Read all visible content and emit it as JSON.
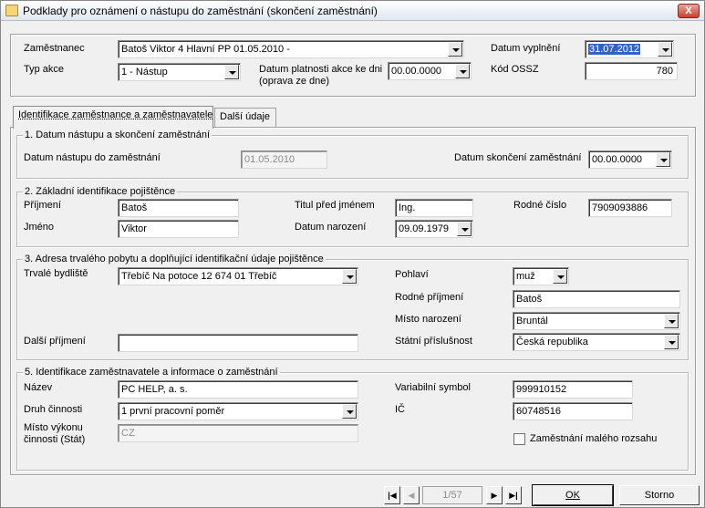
{
  "window": {
    "title": "Podklady pro oznámení o nástupu do zaměstnání (skončení zaměstnání)",
    "close_label": "X"
  },
  "header": {
    "employee_label": "Zaměstnanec",
    "employee_value": "Batoš Viktor 4 Hlavní PP 01.05.2010 -",
    "action_type_label": "Typ akce",
    "action_type_value": "1 - Nástup",
    "validity_label_1": "Datum platnosti akce ke dni",
    "validity_label_2": "(oprava ze dne)",
    "validity_value": "00.00.0000",
    "filled_date_label": "Datum vyplnění",
    "filled_date_value": "31.07.2012",
    "ossz_label": "Kód OSSZ",
    "ossz_value": "780"
  },
  "tabs": [
    {
      "label": "Identifikace zaměstnance a zaměstnavatele"
    },
    {
      "label": "Další údaje"
    }
  ],
  "section1": {
    "title": "1. Datum nástupu a skončení zaměstnání",
    "start_label": "Datum nástupu do zaměstnání",
    "start_value": "01.05.2010",
    "end_label": "Datum skončení zaměstnání",
    "end_value": "00.00.0000"
  },
  "section2": {
    "title": "2. Základní identifikace pojištěnce",
    "surname_label": "Příjmení",
    "surname_value": "Batoš",
    "firstname_label": "Jméno",
    "firstname_value": "Viktor",
    "title_label": "Titul před jménem",
    "title_value": "Ing.",
    "birthdate_label": "Datum narození",
    "birthdate_value": "09.09.1979",
    "birthnumber_label": "Rodné číslo",
    "birthnumber_value": "7909093886"
  },
  "section3": {
    "title": "3. Adresa trvalého pobytu a doplňující identifikační údaje pojištěnce",
    "address_label": "Trvalé bydliště",
    "address_value": "Třebíč  Na potoce 12    674 01 Třebíč",
    "gender_label": "Pohlaví",
    "gender_value": "muž",
    "maiden_label": "Rodné příjmení",
    "maiden_value": "Batoš",
    "birthplace_label": "Místo narození",
    "birthplace_value": "Bruntál",
    "other_surname_label": "Další příjmení",
    "other_surname_value": "",
    "citizenship_label": "Státní příslušnost",
    "citizenship_value": "Česká republika"
  },
  "section5": {
    "title": "5. Identifikace zaměstnavatele a informace o zaměstnání",
    "name_label": "Název",
    "name_value": "PC HELP, a. s.",
    "activity_label": "Druh činnosti",
    "activity_value": "1 první pracovní poměr",
    "place_label_1": "Místo výkonu",
    "place_label_2": "činnosti (Stát)",
    "place_value": "CZ",
    "varsym_label": "Variabilní symbol",
    "varsym_value": "999910152",
    "ic_label": "IČ",
    "ic_value": "60748516",
    "small_job_label": "Zaměstnání malého rozsahu"
  },
  "footer": {
    "first_label": "|◀",
    "prev_label": "◀",
    "counter": "1/57",
    "next_label": "▶",
    "last_label": "▶|",
    "ok_label": "OK",
    "cancel_label": "Storno"
  }
}
